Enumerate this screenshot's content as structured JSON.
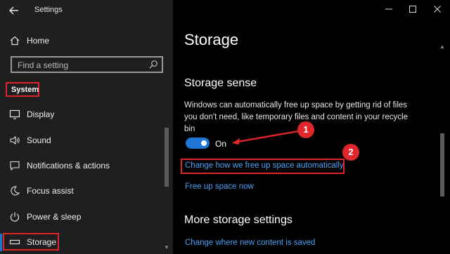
{
  "app": {
    "title": "Settings"
  },
  "sidebar": {
    "home_label": "Home",
    "search_placeholder": "Find a setting",
    "section_label": "System",
    "items": [
      {
        "label": "Display",
        "icon": "display-icon"
      },
      {
        "label": "Sound",
        "icon": "speaker-icon"
      },
      {
        "label": "Notifications & actions",
        "icon": "notification-icon"
      },
      {
        "label": "Focus assist",
        "icon": "moon-icon"
      },
      {
        "label": "Power & sleep",
        "icon": "power-icon"
      },
      {
        "label": "Storage",
        "icon": "storage-icon",
        "selected": true
      }
    ]
  },
  "main": {
    "page_title": "Storage",
    "storage_sense": {
      "heading": "Storage sense",
      "description": "Windows can automatically free up space by getting rid of files you don't need, like temporary files and content in your recycle bin",
      "toggle_state": "On",
      "toggle_on": true,
      "link_change_how": "Change how we free up space automatically",
      "link_free_up": "Free up space now"
    },
    "more_storage": {
      "heading": "More storage settings",
      "link_change_where": "Change where new content is saved"
    }
  },
  "annotations": {
    "badge_1": "1",
    "badge_2": "2"
  },
  "colors": {
    "accent": "#1f74d4",
    "link": "#4ea1f5",
    "highlight": "#e0262a",
    "sidebar_bg": "#1f1f1f",
    "main_bg": "#000000"
  }
}
